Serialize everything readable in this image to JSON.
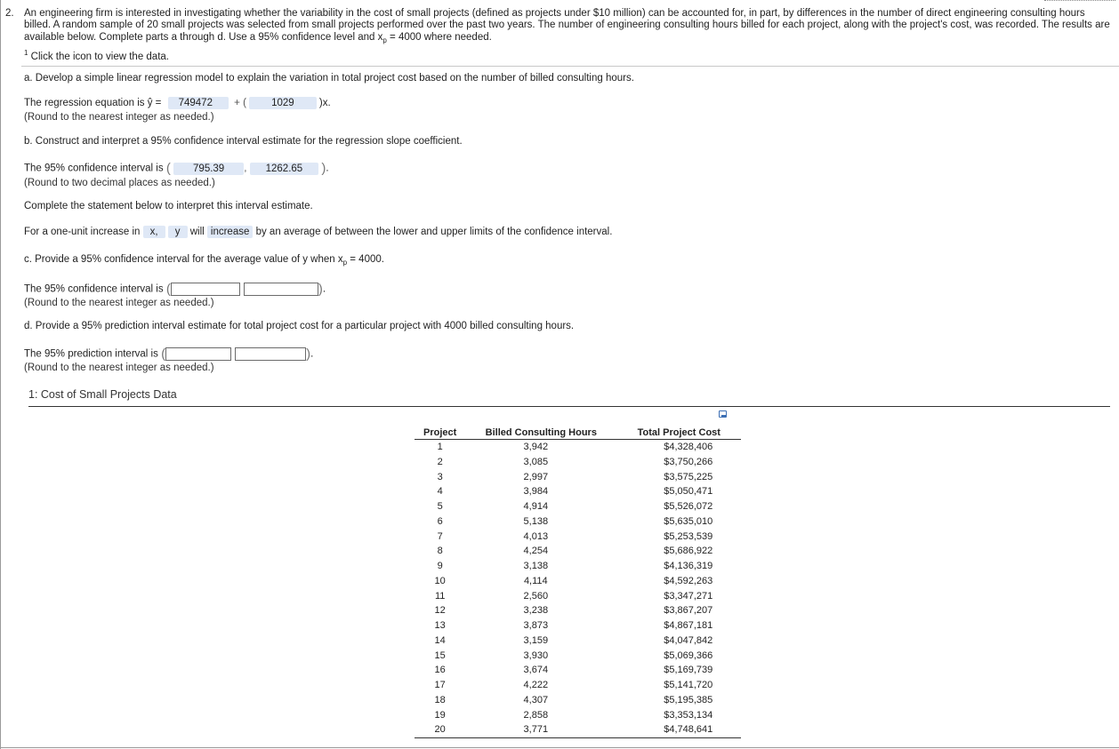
{
  "question": {
    "number": "2.",
    "intro": "An engineering firm is interested in investigating whether the variability in the cost of small projects (defined as projects under $10 million) can be accounted for, in part, by differences in the number of direct engineering consulting hours billed. A random sample of 20 small projects was selected from small projects performed over the past two years. The number of engineering consulting hours billed for each project, along with the project's cost, was recorded. The results are available below. Complete parts a through d. Use a 95% confidence level and x",
    "intro_sub": "p",
    "intro_end": " = 4000 where needed.",
    "footnote_marker": "1",
    "footnote": "Click the icon to view the data."
  },
  "part_a": {
    "prompt": "a. Develop a simple linear regression model to explain the variation in total project cost based on the number of billed consulting hours.",
    "lead": "The regression equation is ",
    "yhat": "ŷ",
    "equals": " =",
    "intercept": "749472",
    "plus": "+ (",
    "slope": "1029",
    "close": ")x.",
    "round_note": "(Round to the nearest integer as needed.)"
  },
  "part_b": {
    "prompt": "b. Construct and interpret a 95% confidence interval estimate for the regression slope coefficient.",
    "lead": "The 95% confidence interval is",
    "lower": "795.39",
    "upper": "1262.65",
    "round_note": "(Round to two decimal places as needed.)",
    "complete_prompt": "Complete the statement below to interpret this interval estimate.",
    "stmt_lead": "For a one-unit increase in",
    "var1": "x,",
    "var2": "y",
    "will": "will",
    "direction": "increase",
    "stmt_end": "by an average of between the lower and upper limits of the confidence interval."
  },
  "part_c": {
    "prompt_pre": "c. Provide a 95% confidence interval for the average value of y when x",
    "prompt_sub": "p",
    "prompt_post": " = 4000.",
    "lead": "The 95% confidence interval is",
    "round_note": "(Round to the nearest integer as needed.)"
  },
  "part_d": {
    "prompt": "d. Provide a 95% prediction interval estimate for total project cost for a particular project with 4000 billed consulting hours.",
    "lead": "The 95% prediction interval is",
    "round_note": "(Round to the nearest integer as needed.)"
  },
  "data_panel": {
    "title": "1: Cost of Small Projects Data",
    "copy_icon": "copy-icon",
    "columns": [
      "Project",
      "Billed Consulting Hours",
      "Total Project Cost"
    ],
    "rows": [
      [
        "1",
        "3,942",
        "$4,328,406"
      ],
      [
        "2",
        "3,085",
        "$3,750,266"
      ],
      [
        "3",
        "2,997",
        "$3,575,225"
      ],
      [
        "4",
        "3,984",
        "$5,050,471"
      ],
      [
        "5",
        "4,914",
        "$5,526,072"
      ],
      [
        "6",
        "5,138",
        "$5,635,010"
      ],
      [
        "7",
        "4,013",
        "$5,253,539"
      ],
      [
        "8",
        "4,254",
        "$5,686,922"
      ],
      [
        "9",
        "3,138",
        "$4,136,319"
      ],
      [
        "10",
        "4,114",
        "$4,592,263"
      ],
      [
        "11",
        "2,560",
        "$3,347,271"
      ],
      [
        "12",
        "3,238",
        "$3,867,207"
      ],
      [
        "13",
        "3,873",
        "$4,867,181"
      ],
      [
        "14",
        "3,159",
        "$4,047,842"
      ],
      [
        "15",
        "3,930",
        "$5,069,366"
      ],
      [
        "16",
        "3,674",
        "$5,169,739"
      ],
      [
        "17",
        "4,222",
        "$5,141,720"
      ],
      [
        "18",
        "4,307",
        "$5,195,385"
      ],
      [
        "19",
        "2,858",
        "$3,353,134"
      ],
      [
        "20",
        "3,771",
        "$4,748,641"
      ]
    ]
  }
}
